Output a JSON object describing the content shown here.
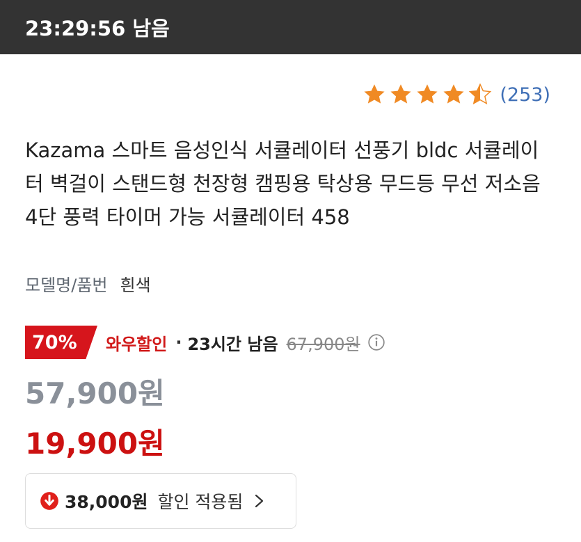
{
  "header": {
    "timer_text": "23:29:56 남음"
  },
  "rating": {
    "stars": 4.5,
    "star_icons": [
      "star-full-icon",
      "star-full-icon",
      "star-full-icon",
      "star-full-icon",
      "star-half-icon"
    ],
    "review_count": "(253)"
  },
  "product": {
    "title": "Kazama 스마트 음성인식 서큘레이터 선풍기 bldc 서큘레이터 벽걸이 스탠드형 천장형 캠핑용 탁상용 무드등 무선 저소음 4단 풍력 타이머 가능 서큘레이터 458",
    "model_label": "모델명/품번",
    "model_value": "흰색"
  },
  "discount": {
    "badge": "70%",
    "label": "와우할인",
    "separator": "·",
    "remaining": "23시간 남음",
    "original_price": "67,900원"
  },
  "prices": {
    "sale_price": "57,900원",
    "final_price": "19,900원"
  },
  "applied_discount": {
    "amount": "38,000원",
    "text": "할인 적용됨"
  },
  "colors": {
    "accent_red": "#d6151c",
    "star_orange": "#f08a24",
    "link_blue": "#3f6fb6",
    "header_bg": "#333333"
  }
}
